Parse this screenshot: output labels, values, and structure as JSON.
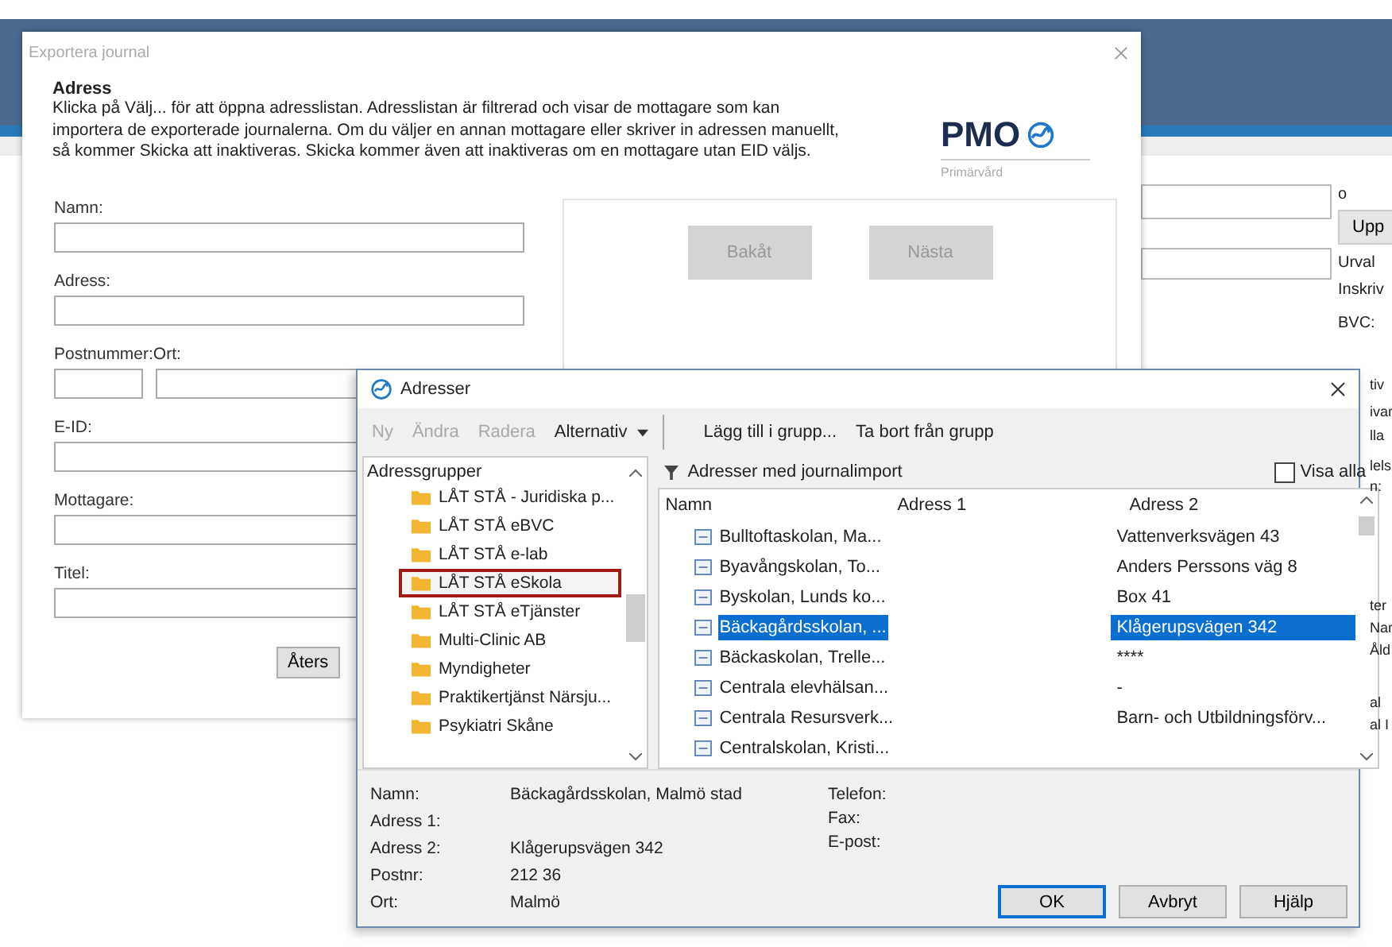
{
  "background_app": {
    "side_button": "Upp",
    "side_texts": [
      "o",
      "Urval",
      "Inskriv",
      "BVC:",
      "tiv",
      "ivar",
      "lla",
      "lels",
      "n:",
      "ter",
      "Nar",
      "Åld",
      "al",
      "al I"
    ]
  },
  "export_dialog": {
    "title": "Exportera journal",
    "heading": "Adress",
    "description": "Klicka på Välj... för att öppna adresslistan. Adresslistan är filtrerad och visar de mottagare som kan importera de exporterade journalerna. Om du väljer en annan mottagare eller skriver in adressen manuellt, så kommer Skicka att inaktiveras. Skicka kommer även att inaktiveras om en mottagare utan EID väljs.",
    "logo": {
      "name": "PMO",
      "subtitle": "Primärvård"
    },
    "fields": [
      {
        "label": "Namn:",
        "kind": "single"
      },
      {
        "label": "Adress:",
        "kind": "single"
      },
      {
        "label": "Postnummer:Ort:",
        "kind": "split"
      },
      {
        "label": "E-ID:",
        "kind": "single"
      },
      {
        "label": "Mottagare:",
        "kind": "single"
      },
      {
        "label": "Titel:",
        "kind": "single"
      }
    ],
    "reset_button": "Åters",
    "nav_buttons": [
      {
        "label": "Bakåt",
        "disabled": true
      },
      {
        "label": "Nästa",
        "disabled": true
      }
    ]
  },
  "address_dialog": {
    "title": "Adresser",
    "toolbar": [
      {
        "label": "Ny",
        "disabled": true,
        "kind": "button"
      },
      {
        "label": "Ändra",
        "disabled": true,
        "kind": "button"
      },
      {
        "label": "Radera",
        "disabled": true,
        "kind": "button"
      },
      {
        "label": "Alternativ",
        "disabled": false,
        "kind": "dropdown"
      },
      {
        "label": "Lägg till i grupp...",
        "disabled": false,
        "kind": "button"
      },
      {
        "label": "Ta bort från grupp",
        "disabled": false,
        "kind": "button"
      }
    ],
    "groups": {
      "header": "Adressgrupper",
      "items": [
        {
          "label": "LÅT STÅ - Juridiska p...",
          "selected": false
        },
        {
          "label": "LÅT STÅ eBVC",
          "selected": false
        },
        {
          "label": "LÅT STÅ e-lab",
          "selected": false
        },
        {
          "label": "LÅT STÅ eSkola",
          "selected": true
        },
        {
          "label": "LÅT STÅ eTjänster",
          "selected": false
        },
        {
          "label": "Multi-Clinic AB",
          "selected": false
        },
        {
          "label": "Myndigheter",
          "selected": false
        },
        {
          "label": "Praktikertjänst Närsju...",
          "selected": false
        },
        {
          "label": "Psykiatri Skåne",
          "selected": false
        }
      ]
    },
    "list": {
      "filter_label": "Adresser med journalimport",
      "show_all": {
        "label": "Visa alla",
        "checked": false
      },
      "columns": [
        "Namn",
        "Adress 1",
        "Adress 2"
      ],
      "rows": [
        {
          "name": "Bulltoftaskolan, Ma...",
          "address_2": "Vattenverksvägen 43",
          "selected": false
        },
        {
          "name": "Byavångskolan, To...",
          "address_2": "Anders Perssons väg 8",
          "selected": false
        },
        {
          "name": "Byskolan, Lunds ko...",
          "address_2": "Box 41",
          "selected": false
        },
        {
          "name": "Bäckagårdsskolan, ...",
          "address_2": "Klågerupsvägen 342",
          "selected": true
        },
        {
          "name": "Bäckaskolan, Trelle...",
          "address_2": "****",
          "selected": false
        },
        {
          "name": "Centrala elevhälsan...",
          "address_2": "-",
          "selected": false
        },
        {
          "name": "Centrala Resursverk...",
          "address_2": "Barn- och Utbildningsförv...",
          "selected": false
        },
        {
          "name": "Centralskolan, Kristi...",
          "selected": false
        }
      ]
    },
    "details": {
      "left": [
        {
          "label": "Namn:",
          "value": "Bäckagårdsskolan, Malmö stad"
        },
        {
          "label": "Adress 1:"
        },
        {
          "label": "Adress 2:",
          "value": "Klågerupsvägen 342"
        },
        {
          "label": "Postnr:",
          "value": "212 36"
        },
        {
          "label": "Ort:",
          "value": "Malmö"
        }
      ],
      "right": [
        "Telefon:",
        "Fax:",
        "E-post:"
      ]
    },
    "buttons": [
      {
        "label": "OK",
        "default": true
      },
      {
        "label": "Avbryt",
        "default": false
      },
      {
        "label": "Hjälp",
        "default": false
      }
    ]
  }
}
